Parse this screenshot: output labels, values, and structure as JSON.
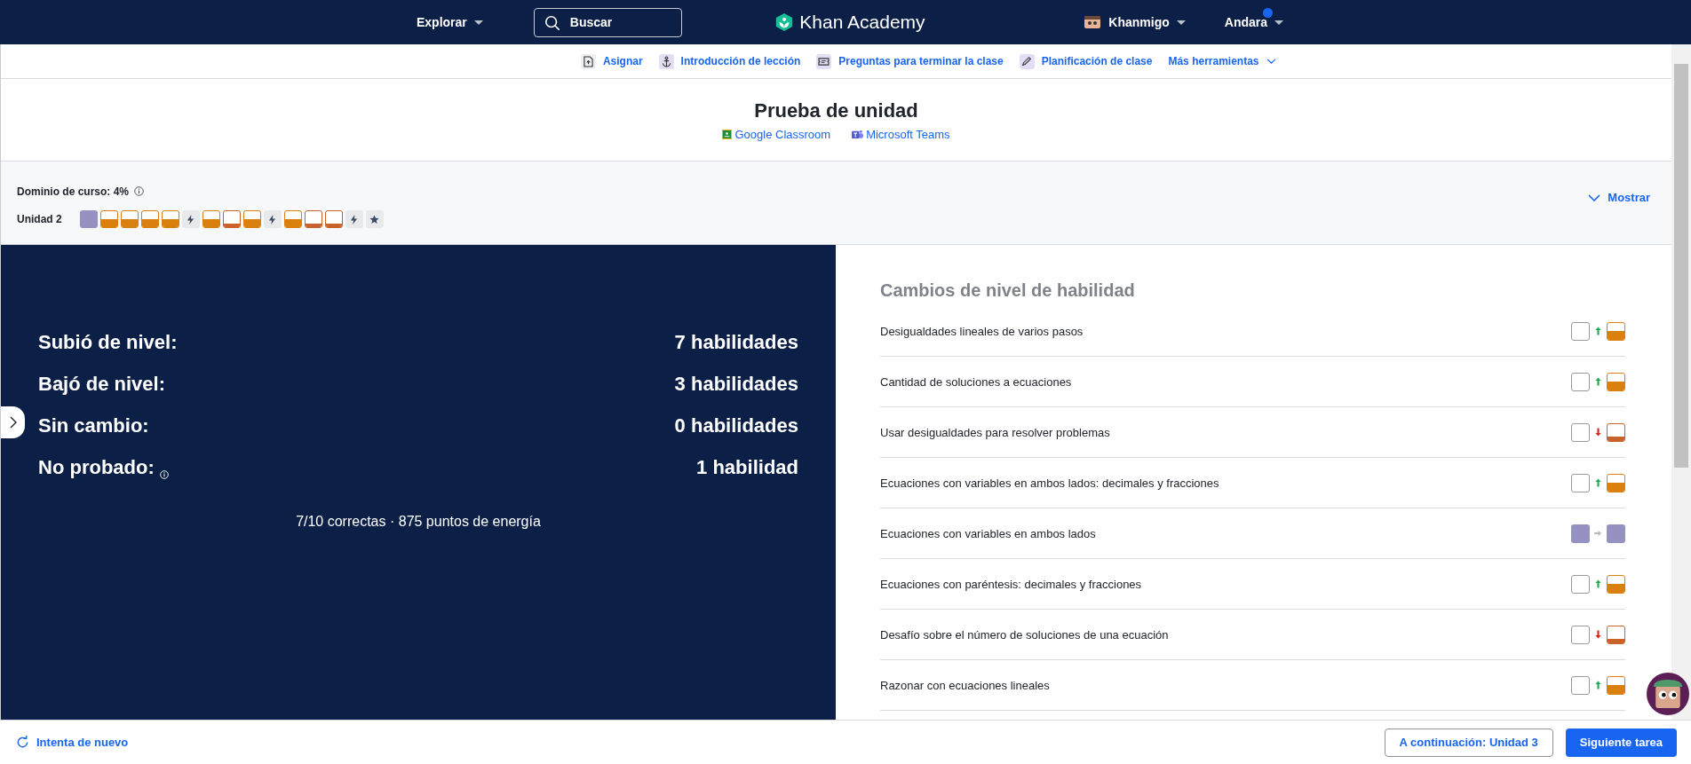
{
  "nav": {
    "explore": "Explorar",
    "search_placeholder": "Buscar",
    "logo": "Khan Academy",
    "khanmigo": "Khanmigo",
    "user": "Andara"
  },
  "tools": [
    {
      "label": "Asignar",
      "kind": "assign"
    },
    {
      "label": "Introducción de lección",
      "kind": "hook"
    },
    {
      "label": "Preguntas para terminar la clase",
      "kind": "ticket"
    },
    {
      "label": "Planificación de clase",
      "kind": "plan"
    }
  ],
  "more_tools": "Más herramientas",
  "header": {
    "title": "Prueba de unidad",
    "share": [
      {
        "label": "Google Classroom",
        "kind": "classroom"
      },
      {
        "label": "Microsoft Teams",
        "kind": "teams"
      }
    ]
  },
  "mastery": {
    "label": "Dominio de curso: 4%",
    "toggle": "Mostrar",
    "unit": "Unidad 2",
    "skills": [
      {
        "kind": "mastered"
      },
      {
        "kind": "proficient"
      },
      {
        "kind": "proficient"
      },
      {
        "kind": "proficient"
      },
      {
        "kind": "proficient"
      },
      {
        "kind": "quiz"
      },
      {
        "kind": "proficient"
      },
      {
        "kind": "familiar"
      },
      {
        "kind": "proficient"
      },
      {
        "kind": "quiz"
      },
      {
        "kind": "proficient"
      },
      {
        "kind": "familiar"
      },
      {
        "kind": "familiar"
      },
      {
        "kind": "quiz"
      },
      {
        "kind": "unit-test"
      }
    ]
  },
  "results": {
    "stats": [
      {
        "label": "Subió de nivel:",
        "value": "7 habilidades",
        "info": false
      },
      {
        "label": "Bajó de nivel:",
        "value": "3 habilidades",
        "info": false
      },
      {
        "label": "Sin cambio:",
        "value": "0 habilidades",
        "info": false
      },
      {
        "label": "No probado:",
        "value": "1 habilidad",
        "info": true
      }
    ],
    "summary": "7/10 correctas · 875 puntos de energía"
  },
  "changes": {
    "title": "Cambios de nivel de habilidad",
    "rows": [
      {
        "skill": "Desigualdades lineales de varios pasos",
        "from": {
          "kind": "not-started"
        },
        "change": {
          "kind": "up"
        },
        "to": {
          "kind": "proficient"
        }
      },
      {
        "skill": "Cantidad de soluciones a ecuaciones",
        "from": {
          "kind": "not-started"
        },
        "change": {
          "kind": "up"
        },
        "to": {
          "kind": "proficient"
        }
      },
      {
        "skill": "Usar desigualdades para resolver problemas",
        "from": {
          "kind": "not-started"
        },
        "change": {
          "kind": "down"
        },
        "to": {
          "kind": "familiar"
        }
      },
      {
        "skill": "Ecuaciones con variables en ambos lados: decimales y fracciones",
        "from": {
          "kind": "not-started"
        },
        "change": {
          "kind": "up"
        },
        "to": {
          "kind": "proficient"
        }
      },
      {
        "skill": "Ecuaciones con variables en ambos lados",
        "from": {
          "kind": "mastered"
        },
        "change": {
          "kind": "same"
        },
        "to": {
          "kind": "mastered"
        }
      },
      {
        "skill": "Ecuaciones con paréntesis: decimales y fracciones",
        "from": {
          "kind": "not-started"
        },
        "change": {
          "kind": "up"
        },
        "to": {
          "kind": "proficient"
        }
      },
      {
        "skill": "Desafío sobre el número de soluciones de una ecuación",
        "from": {
          "kind": "not-started"
        },
        "change": {
          "kind": "down"
        },
        "to": {
          "kind": "familiar"
        }
      },
      {
        "skill": "Razonar con ecuaciones lineales",
        "from": {
          "kind": "not-started"
        },
        "change": {
          "kind": "up"
        },
        "to": {
          "kind": "proficient"
        }
      }
    ]
  },
  "footer": {
    "retry": "Intenta de nuevo",
    "next_unit": "A continuación: Unidad 3",
    "next_task": "Siguiente tarea"
  }
}
